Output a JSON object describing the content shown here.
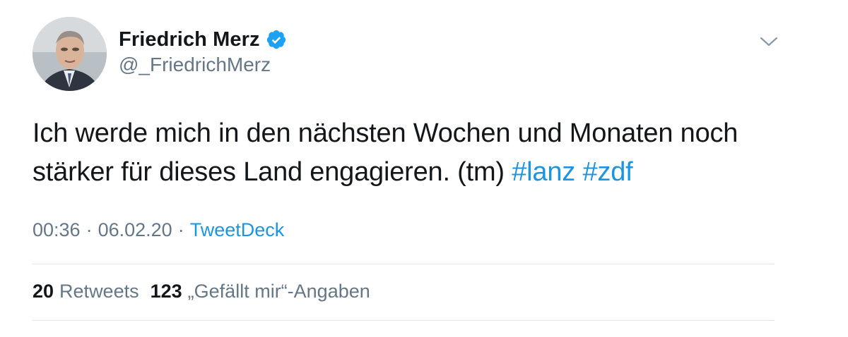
{
  "author": {
    "display_name": "Friedrich Merz",
    "handle": "@_FriedrichMerz",
    "verified": true
  },
  "tweet": {
    "text_plain": "Ich werde mich in den nächsten Wochen und Monaten noch stärker für dieses Land engagieren. (tm) ",
    "hashtags": [
      "#lanz",
      "#zdf"
    ]
  },
  "meta": {
    "time": "00:36",
    "separator": "·",
    "date": "06.02.20",
    "source": "TweetDeck"
  },
  "stats": {
    "retweets_count": "20",
    "retweets_label": "Retweets",
    "likes_count": "123",
    "likes_label": "„Gefällt mir“-Angaben"
  },
  "colors": {
    "link": "#1b95e0",
    "secondary_text": "#657786",
    "primary_text": "#14171a",
    "divider": "#e1e8ed"
  },
  "icons": {
    "verified": "verified-badge-icon",
    "menu": "chevron-down-icon"
  }
}
